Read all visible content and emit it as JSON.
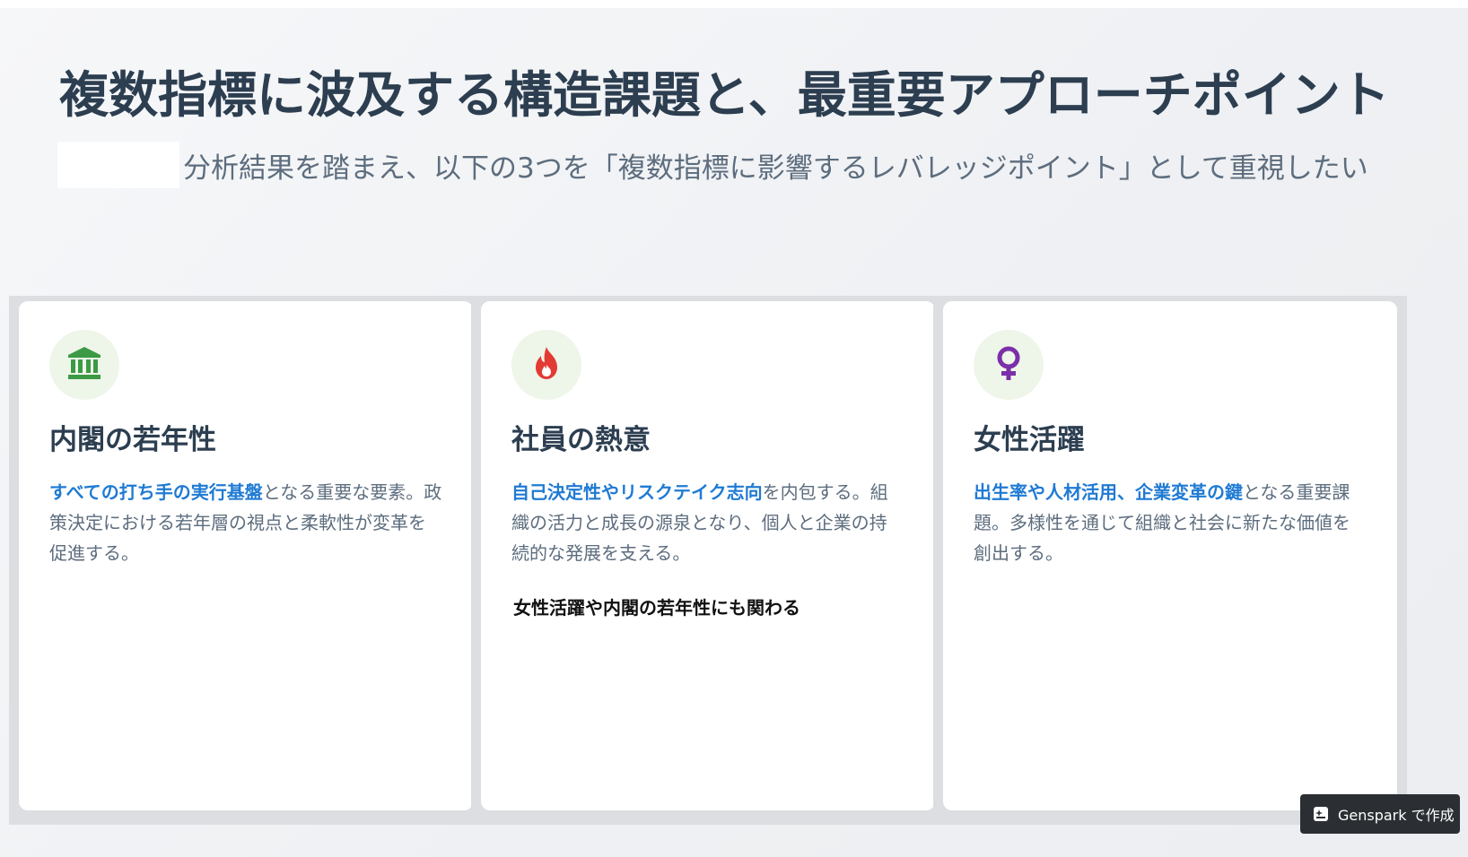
{
  "header": {
    "title": "複数指標に波及する構造課題と、最重要アプローチポイント",
    "subtitle": "分析結果を踏まえ、以下の3つを「複数指標に影響するレバレッジポイント」として重視したい"
  },
  "cards": [
    {
      "icon": "landmark-icon",
      "icon_color": "#3c9a45",
      "title": "内閣の若年性",
      "highlight": "すべての打ち手の実行基盤",
      "desc": "となる重要な要素。政策決定における若年層の視点と柔軟性が変革を促進する。",
      "note": ""
    },
    {
      "icon": "fire-icon",
      "icon_color": "#e23b34",
      "title": "社員の熱意",
      "highlight": "自己決定性やリスクテイク志向",
      "desc": "を内包する。組織の活力と成長の源泉となり、個人と企業の持続的な発展を支える。",
      "note": "女性活躍や内閣の若年性にも関わる"
    },
    {
      "icon": "venus-icon",
      "icon_color": "#7b2fa8",
      "title": "女性活躍",
      "highlight": "出生率や人材活用、企業変革の鍵",
      "desc": "となる重要課題。多様性を通じて組織と社会に新たな価値を創出する。",
      "note": ""
    }
  ],
  "badge": {
    "label": "Genspark で作成"
  },
  "colors": {
    "title": "#2c3e50",
    "subtitle": "#5d6d7e",
    "highlight": "#1f7ad3",
    "icon_bg": "#eef5e9"
  }
}
